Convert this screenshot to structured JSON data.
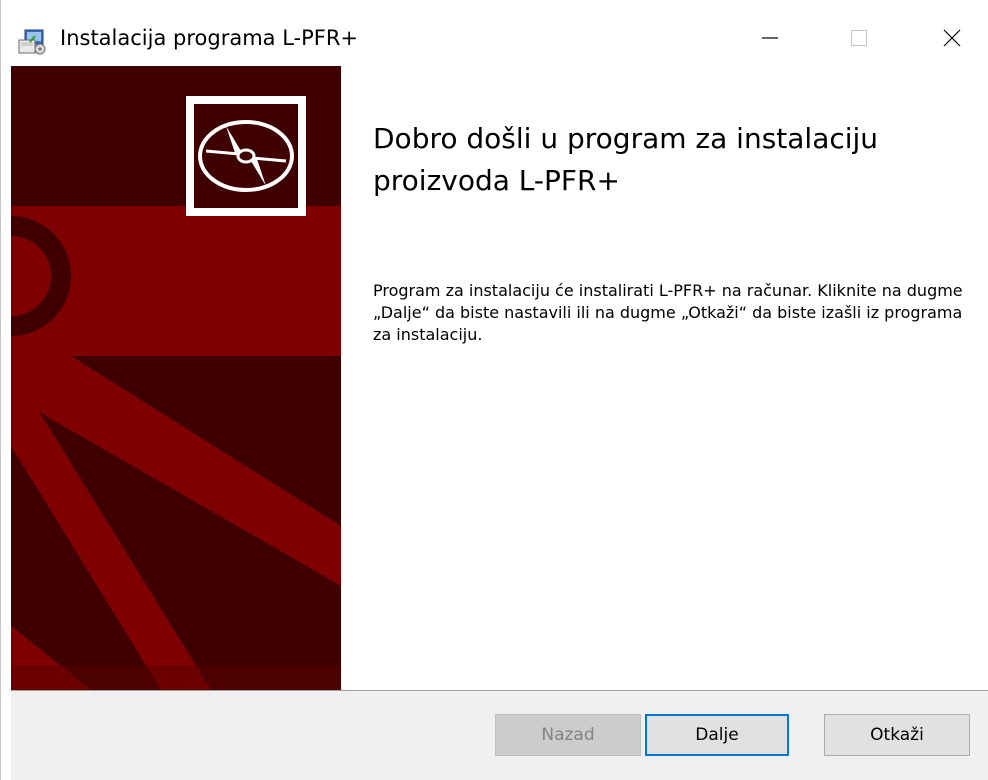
{
  "window": {
    "title": "Instalacija programa L-PFR+",
    "controls": {
      "minimize_icon": "minimize-icon",
      "maximize_icon": "maximize-icon",
      "close_icon": "close-icon"
    }
  },
  "banner": {
    "icon": "disc-icon",
    "colors": {
      "dark": "#3f0000",
      "red": "#7f0000"
    }
  },
  "content": {
    "heading": "Dobro došli u program za instalaciju proizvoda L-PFR+",
    "body": "Program za instalaciju će instalirati L-PFR+ na računar. Kliknite na dugme „Dalje“ da biste nastavili ili na dugme „Otkaži“ da biste izašli iz programa za instalaciju."
  },
  "footer": {
    "back_label": "Nazad",
    "next_label": "Dalje",
    "cancel_label": "Otkaži"
  },
  "colors": {
    "accent": "#0078d7",
    "footer_bg": "#f0f0f0",
    "button_bg": "#e1e1e1"
  }
}
